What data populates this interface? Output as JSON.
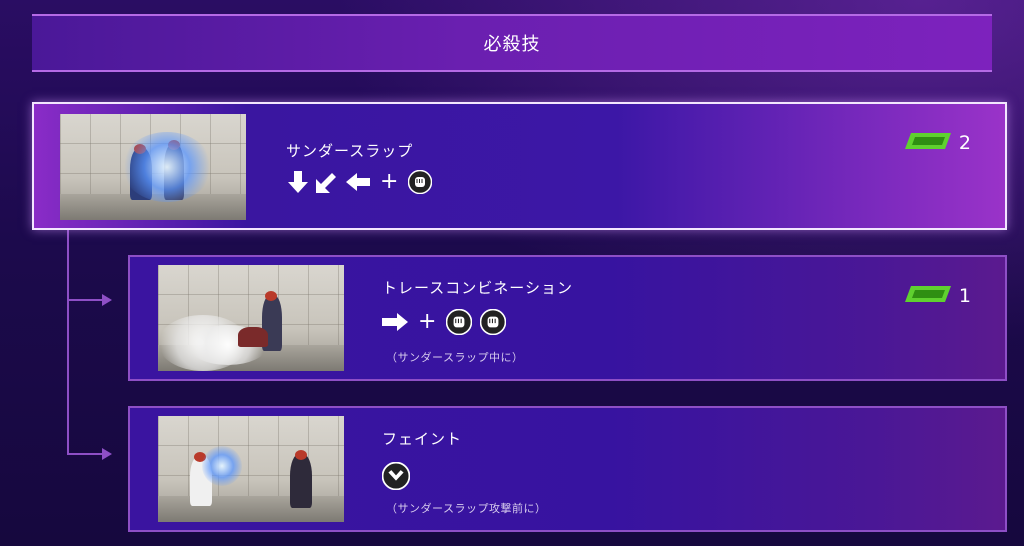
{
  "header": {
    "title": "必殺技"
  },
  "moves": [
    {
      "name": "サンダースラップ",
      "command": [
        "arrow-down",
        "arrow-down-left",
        "arrow-left",
        "plus",
        "punch-button"
      ],
      "note": "",
      "gauge_count": "2"
    },
    {
      "name": "トレースコンビネーション",
      "command": [
        "arrow-right",
        "plus",
        "punch-button",
        "punch-button"
      ],
      "note": "（サンダースラップ中に）",
      "gauge_count": "1"
    },
    {
      "name": "フェイント",
      "command": [
        "chevron-down-button"
      ],
      "note": "（サンダースラップ攻撃前に）",
      "gauge_count": ""
    }
  ],
  "colors": {
    "gauge_green": "#5fd12f",
    "accent_purple": "#8e4fc6",
    "selected_border": "#f3e6ff"
  },
  "plus_symbol": "+"
}
